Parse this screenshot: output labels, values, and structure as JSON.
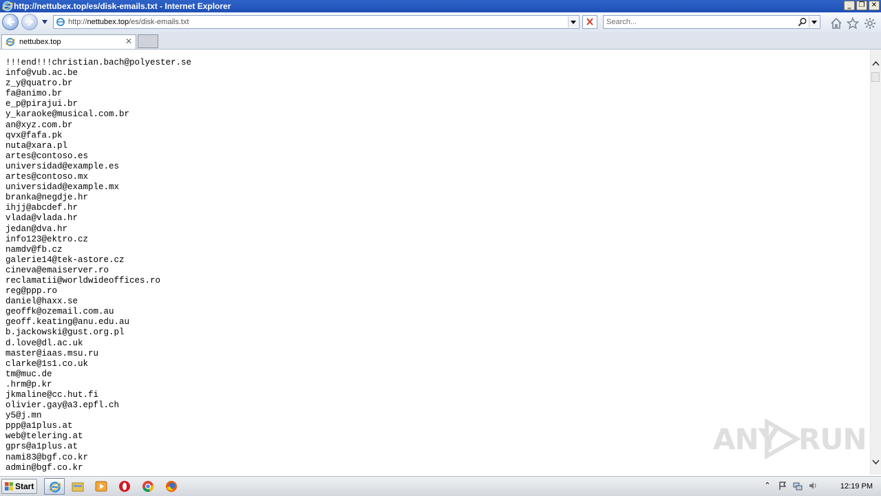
{
  "window": {
    "title": "http://nettubex.top/es/disk-emails.txt - Internet Explorer",
    "controls": [
      "minimize",
      "restore",
      "close"
    ]
  },
  "address_bar": {
    "url_prefix": "http://",
    "url_host": "nettubex.top",
    "url_path": "/es/disk-emails.txt"
  },
  "search": {
    "placeholder": "Search..."
  },
  "tabs": [
    {
      "label": "nettubex.top",
      "active": true
    }
  ],
  "content": {
    "lines": [
      "!!!end!!!christian.bach@polyester.se",
      "info@vub.ac.be",
      "z_y@quatro.br",
      "fa@animo.br",
      "e_p@pirajui.br",
      "y_karaoke@musical.com.br",
      "an@xyz.com.br",
      "qvx@fafa.pk",
      "nuta@xara.pl",
      "artes@contoso.es",
      "universidad@example.es",
      "artes@contoso.mx",
      "universidad@example.mx",
      "branka@negdje.hr",
      "ihjj@abcdef.hr",
      "vlada@vlada.hr",
      "jedan@dva.hr",
      "info123@ektro.cz",
      "namdv@fb.cz",
      "galerie14@tek-astore.cz",
      "cineva@emaiserver.ro",
      "reclamatii@worldwideoffices.ro",
      "reg@ppp.ro",
      "daniel@haxx.se",
      "geoffk@ozemail.com.au",
      "geoff.keating@anu.edu.au",
      "b.jackowski@gust.org.pl",
      "d.love@dl.ac.uk",
      "master@iaas.msu.ru",
      "clarke@1s1.co.uk",
      "tm@muc.de",
      ".hrm@p.kr",
      "jkmaline@cc.hut.fi",
      "olivier.gay@a3.epfl.ch",
      "y5@j.mn",
      "ppp@a1plus.at",
      "web@telering.at",
      "gprs@a1plus.at",
      "nami83@bgf.co.kr",
      "admin@bgf.co.kr"
    ]
  },
  "watermark": {
    "text_left": "ANY",
    "text_right": "RUN"
  },
  "taskbar": {
    "start_label": "Start",
    "apps": [
      "internet-explorer",
      "file-explorer",
      "media-player",
      "opera",
      "chrome",
      "firefox"
    ],
    "clock": "12:19 PM"
  },
  "colors": {
    "titlebar": "#1f4fb5",
    "accent": "#3a6fd0",
    "stop_x": "#d23b2b"
  }
}
